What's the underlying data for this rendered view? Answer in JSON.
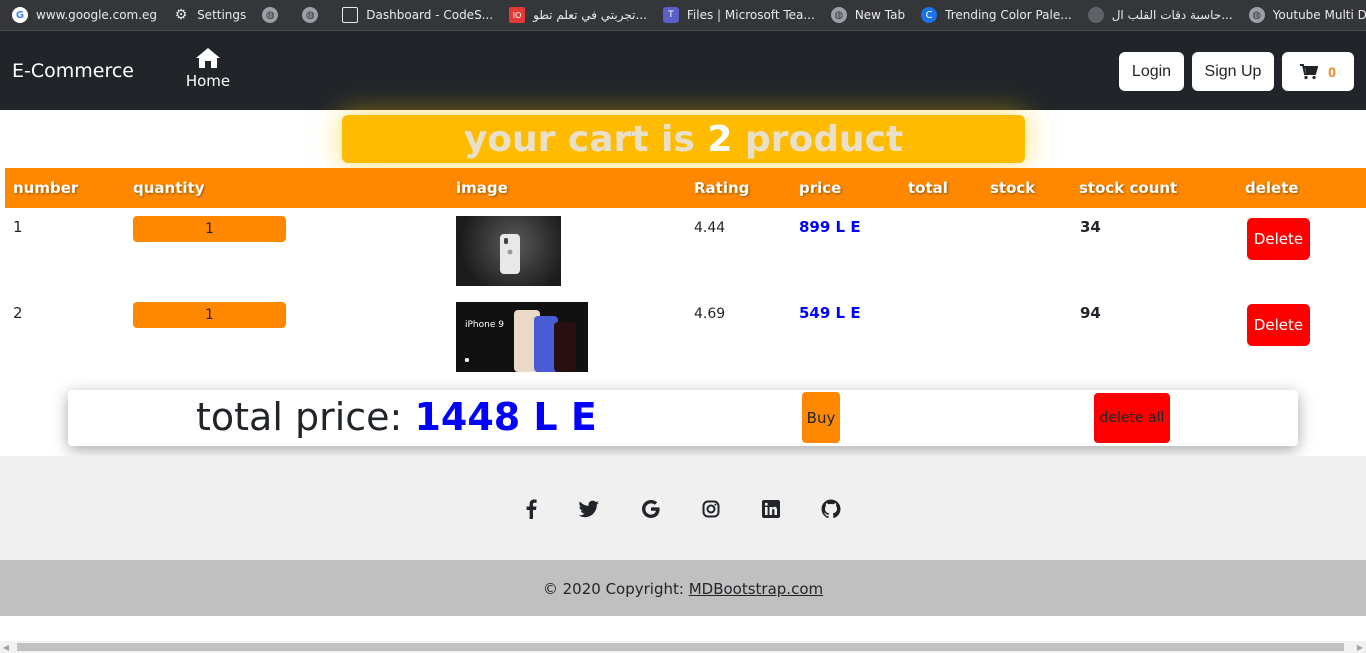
{
  "bookmarks": [
    {
      "label": "www.google.com.eg",
      "icon": "google-icon"
    },
    {
      "label": "Settings",
      "icon": "gear-icon"
    },
    {
      "label": "",
      "icon": "globe-icon"
    },
    {
      "label": "",
      "icon": "globe-icon"
    },
    {
      "label": "Dashboard - CodeS...",
      "icon": "page-icon"
    },
    {
      "label": "تجربتي في تعلم تطو...",
      "icon": "site-icon"
    },
    {
      "label": "Files | Microsoft Tea...",
      "icon": "teams-icon"
    },
    {
      "label": "New Tab",
      "icon": "globe-icon"
    },
    {
      "label": "Trending Color Pale...",
      "icon": "site-icon"
    },
    {
      "label": "حاسبة دقات القلب ال...",
      "icon": "site-icon"
    },
    {
      "label": "Youtube Multi Dow...",
      "icon": "globe-icon"
    }
  ],
  "navbar": {
    "brand": "E-Commerce",
    "home_label": "Home",
    "login_label": "Login",
    "signup_label": "Sign Up",
    "cart_count": "0"
  },
  "banner": {
    "prefix": "your cart is ",
    "count": "2",
    "suffix": " product"
  },
  "table": {
    "headers": [
      "number",
      "quantity",
      "image",
      "Rating",
      "price",
      "total",
      "stock",
      "stock count",
      "delete"
    ],
    "rows": [
      {
        "number": "1",
        "quantity": "1",
        "rating": "4.44",
        "price": "899 L E",
        "stock_count": "34",
        "delete_label": "Delete"
      },
      {
        "number": "2",
        "quantity": "1",
        "rating": "4.69",
        "price": "549 L E",
        "stock_count": "94",
        "delete_label": "Delete"
      }
    ],
    "row2_image_text": "iPhone 9"
  },
  "summary": {
    "total_label": "total price: ",
    "total_amount": "1448 L E",
    "buy_label": "Buy",
    "delete_all_label": "delete all"
  },
  "footer": {
    "social_icons": [
      "facebook-icon",
      "twitter-icon",
      "google-icon",
      "instagram-icon",
      "linkedin-icon",
      "github-icon"
    ],
    "copyright_prefix": "© 2020 Copyright: ",
    "copyright_link": "MDBootstrap.com"
  },
  "colors": {
    "accent_orange": "#ff8800",
    "banner_yellow": "#ffbb00",
    "navbar_dark": "#212529",
    "delete_red": "#ff0000",
    "price_blue": "#0000ff"
  }
}
